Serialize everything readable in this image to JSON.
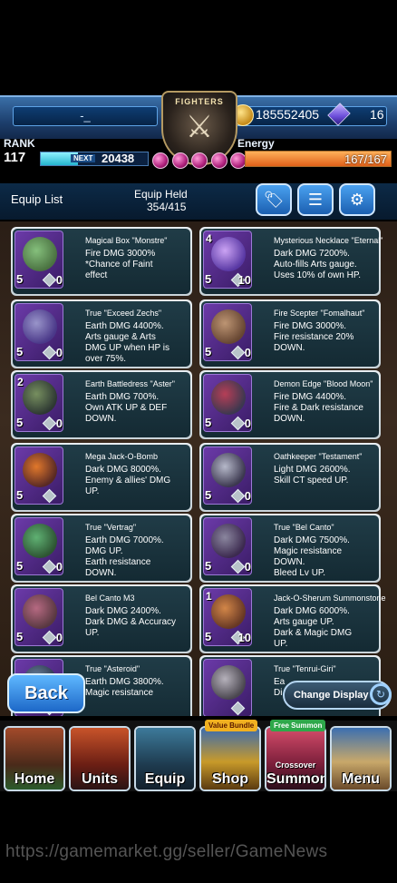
{
  "header": {
    "player_name": "-_",
    "emblem_label": "FIGHTERS",
    "gold": "185552405",
    "gems": "16",
    "rank_label": "RANK",
    "rank": "117",
    "next_label": "NEXT",
    "next_exp": "20438",
    "energy_label": "Energy",
    "energy": "167/167",
    "rank_progress": 0.35,
    "energy_progress": 1.0
  },
  "equip_header": {
    "list_label": "Equip List",
    "held_label": "Equip Held",
    "held_value": "354/415",
    "buttons": [
      "tag-icon",
      "sort-icon",
      "gear-icon"
    ]
  },
  "items": [
    {
      "title": "Magical Box \"Monstre\"",
      "desc": "Fire DMG 3000%\n*Chance of Faint\neffect",
      "level": "5",
      "count": "0",
      "top_num": ""
    },
    {
      "title": "Mysterious Necklace \"Eternal\"",
      "desc": "Dark DMG 7200%.\nAuto-fills Arts gauge.\nUses 10% of own HP.",
      "level": "5",
      "count": "10",
      "top_num": "4"
    },
    {
      "title": "True \"Exceed Zechs\"",
      "desc": "Earth DMG 4400%.\nArts gauge & Arts\nDMG UP when HP is\nover 75%.",
      "level": "5",
      "count": "0",
      "top_num": ""
    },
    {
      "title": "Fire Scepter \"Fomalhaut\"",
      "desc": "Fire DMG 3000%.\nFire resistance 20%\nDOWN.",
      "level": "5",
      "count": "0",
      "top_num": ""
    },
    {
      "title": "Earth Battledress \"Aster\"",
      "desc": "Earth DMG 700%.\nOwn ATK UP & DEF\nDOWN.",
      "level": "5",
      "count": "0",
      "top_num": "2"
    },
    {
      "title": "Demon Edge \"Blood Moon\"",
      "desc": "Fire DMG 4400%.\nFire & Dark resistance\nDOWN.",
      "level": "5",
      "count": "0",
      "top_num": ""
    },
    {
      "title": "Mega Jack-O-Bomb",
      "desc": "Dark DMG 8000%.\nEnemy & allies' DMG\nUP.",
      "level": "5",
      "count": "",
      "top_num": ""
    },
    {
      "title": "Oathkeeper \"Testament\"",
      "desc": "Light DMG 2600%.\nSkill CT speed UP.",
      "level": "5",
      "count": "0",
      "top_num": ""
    },
    {
      "title": "True \"Vertrag\"",
      "desc": "Earth DMG 7000%.\nDMG UP.\nEarth resistance\nDOWN.",
      "level": "5",
      "count": "0",
      "top_num": ""
    },
    {
      "title": "True \"Bel Canto\"",
      "desc": "Dark DMG 7500%.\nMagic resistance\nDOWN.\nBleed Lv UP.",
      "level": "5",
      "count": "0",
      "top_num": ""
    },
    {
      "title": "Bel Canto M3",
      "desc": "Dark DMG 2400%.\nDark DMG & Accuracy\nUP.",
      "level": "5",
      "count": "0",
      "top_num": ""
    },
    {
      "title": "Jack-O-Sherum Summonstone",
      "desc": "Dark DMG 6000%.\nArts gauge UP.\nDark & Magic DMG\nUP.",
      "level": "5",
      "count": "10",
      "top_num": "1"
    },
    {
      "title": "True \"Asteroid\"",
      "desc": "Earth DMG 3800%.\nMagic resistance",
      "level": "5",
      "count": "",
      "top_num": ""
    },
    {
      "title": "True \"Tenrui-Giri\"",
      "desc": "Ea\nDi",
      "level": "",
      "count": "",
      "top_num": ""
    }
  ],
  "actions": {
    "back": "Back",
    "change_display": "Change Display"
  },
  "nav": [
    {
      "label": "Home",
      "badge": ""
    },
    {
      "label": "Units",
      "badge": ""
    },
    {
      "label": "Equip",
      "badge": ""
    },
    {
      "label": "Shop",
      "badge": "Value Bundle"
    },
    {
      "label": "Summon",
      "badge": "Free Summon",
      "sub": "Crossover"
    },
    {
      "label": "Menu",
      "badge": ""
    }
  ],
  "watermark": "https://gamemarket.gg/seller/GameNews",
  "colors": {
    "accent_blue": "#1d68c8",
    "card_bg": "#142a33",
    "energy": "#e0611a",
    "rank_bar": "#24b6cf"
  }
}
